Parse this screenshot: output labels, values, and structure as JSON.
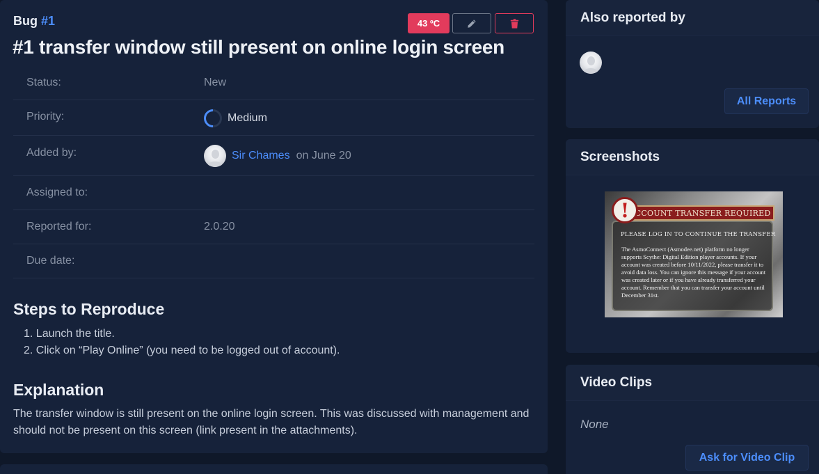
{
  "bug": {
    "label": "Bug",
    "number": "#1",
    "temperature": "43 ºC",
    "title": "#1 transfer window still present on online login screen"
  },
  "details": {
    "status_label": "Status:",
    "status_value": "New",
    "priority_label": "Priority:",
    "priority_value": "Medium",
    "added_by_label": "Added by:",
    "added_by_name": "Sir Chames",
    "added_by_date": "on June 20",
    "assigned_to_label": "Assigned to:",
    "reported_for_label": "Reported for:",
    "reported_for_value": "2.0.20",
    "due_date_label": "Due date:"
  },
  "steps": {
    "heading": "Steps to Reproduce",
    "items": [
      "1. Launch the title.",
      "2. Click on “Play Online” (you need to be logged out of account)."
    ]
  },
  "explanation": {
    "heading": "Explanation",
    "text": "The transfer window is still present on the online login screen. This was discussed with management and should not be present on this screen (link present in the attachments)."
  },
  "sidebar": {
    "also_reported": {
      "heading": "Also reported by",
      "button": "All Reports"
    },
    "screenshots": {
      "heading": "Screenshots",
      "image": {
        "banner": "ACCOUNT TRANSFER REQUIRED",
        "alert": "!",
        "subtitle": "PLEASE LOG IN TO CONTINUE THE TRANSFER",
        "body": "The AsmoConnect (Asmodee.net) platform no longer supports Scythe: Digital Edition player accounts. If your account was created before 10/11/2022, please transfer it to avoid data loss. You can ignore this message if your account was created later or if you have already transferred your account. Remember that you can transfer your account until December 31st."
      }
    },
    "video_clips": {
      "heading": "Video Clips",
      "empty": "None",
      "button": "Ask for Video Clip"
    }
  },
  "colors": {
    "accent": "#4c8dfa",
    "danger": "#e23b5c",
    "card": "#16223a",
    "background": "#0f1829"
  }
}
